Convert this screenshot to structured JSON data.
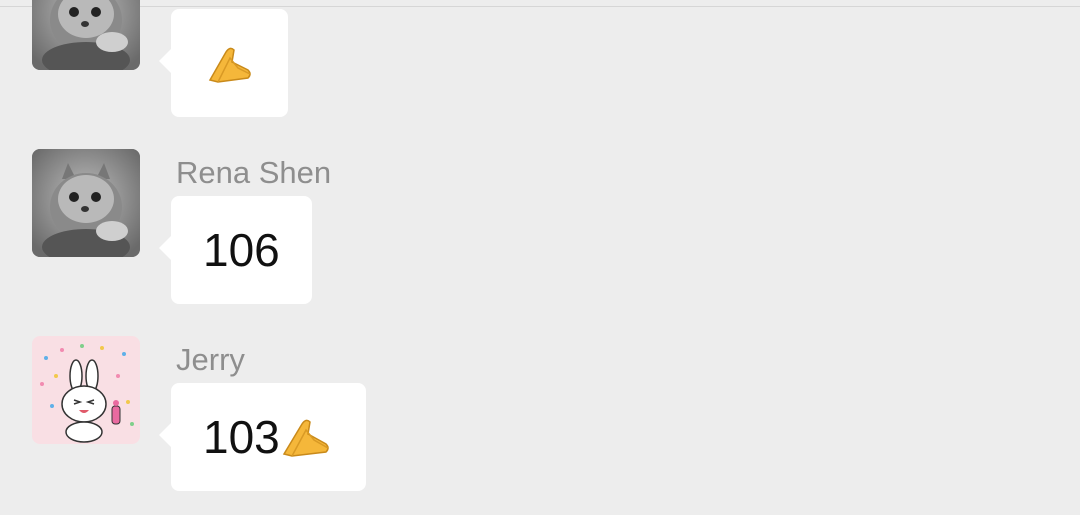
{
  "messages": [
    {
      "sender": "",
      "text": "",
      "emoji": "clap-hands-icon",
      "avatar": "cat-photo"
    },
    {
      "sender": "Rena Shen",
      "text": "106",
      "emoji": "",
      "avatar": "cat-photo"
    },
    {
      "sender": "Jerry",
      "text": "103",
      "emoji": "clap-hands-icon",
      "avatar": "rabbit-sticker"
    }
  ],
  "colors": {
    "background": "#ededed",
    "bubble": "#ffffff",
    "sender_name": "#8e8e8e",
    "text": "#111111",
    "emoji": "#f5b73a"
  }
}
